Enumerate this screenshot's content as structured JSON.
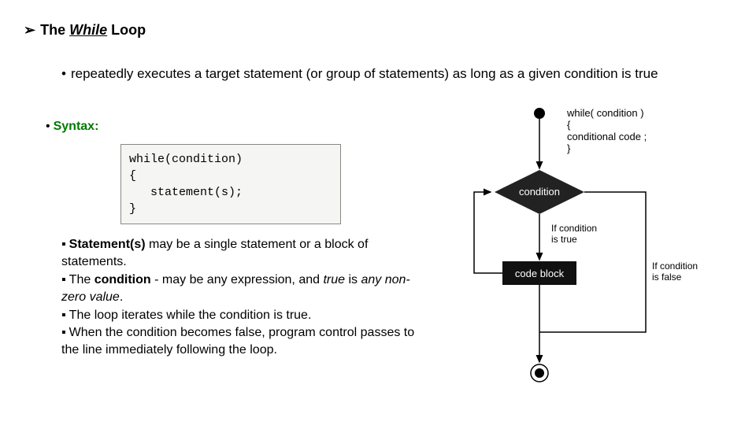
{
  "heading": {
    "arrow_glyph": "➢",
    "title_the": "The ",
    "title_while": "While",
    "title_loop": " Loop"
  },
  "intro": {
    "bullet_glyph": "•",
    "text": "repeatedly executes a target statement (or group of statements) as long as a given condition is true"
  },
  "syntax": {
    "bullet_glyph": "•",
    "label": "Syntax:",
    "code": "while(condition)\n{\n   statement(s);\n}"
  },
  "notes": {
    "bullet_glyph": "▪",
    "n1_strong": "Statement(s)",
    "n1_rest": " may be a single statement or a block of statements.",
    "n2_a": "The ",
    "n2_strong": "condition",
    "n2_b": " - may be any expression, and ",
    "n2_ital_a": "true",
    "n2_c": " is ",
    "n2_ital_b": "any non-zero value",
    "n2_d": ".",
    "n3": "The loop iterates while the condition is true.",
    "n4": "When the condition becomes false, program control passes to the line immediately following the loop."
  },
  "flowchart": {
    "syntax_line1": "while( condition )",
    "syntax_line2": "{",
    "syntax_line3": "   conditional code ;",
    "syntax_line4": "}",
    "node_condition": "condition",
    "node_codeblock": "code block",
    "label_true": "If condition",
    "label_true_b": "is true",
    "label_false": "If condition",
    "label_false_b": "is false"
  }
}
